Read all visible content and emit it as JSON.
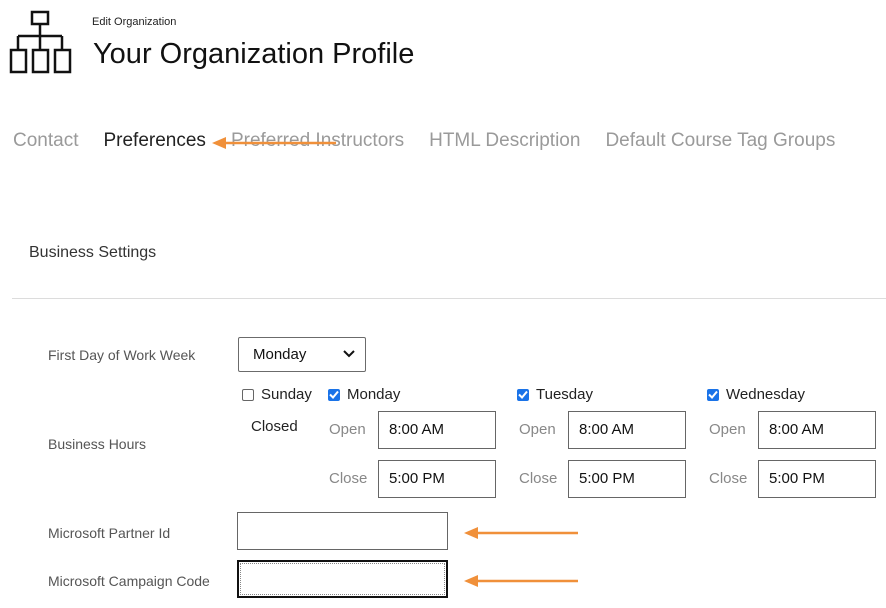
{
  "header": {
    "breadcrumb": "Edit Organization",
    "title": "Your Organization Profile",
    "icon": "org-chart-icon"
  },
  "tabs": [
    {
      "label": "Contact",
      "active": false
    },
    {
      "label": "Preferences",
      "active": true
    },
    {
      "label": "Preferred Instructors",
      "active": false
    },
    {
      "label": "HTML Description",
      "active": false
    },
    {
      "label": "Default Course Tag Groups",
      "active": false
    }
  ],
  "section": {
    "title": "Business Settings"
  },
  "form": {
    "first_day_label": "First Day of Work Week",
    "first_day_value": "Monday",
    "business_hours_label": "Business Hours",
    "days": [
      {
        "name": "Sunday",
        "checked": false,
        "closed_text": "Closed"
      },
      {
        "name": "Monday",
        "checked": true,
        "open_label": "Open",
        "open": "8:00 AM",
        "close_label": "Close",
        "close": "5:00 PM"
      },
      {
        "name": "Tuesday",
        "checked": true,
        "open_label": "Open",
        "open": "8:00 AM",
        "close_label": "Close",
        "close": "5:00 PM"
      },
      {
        "name": "Wednesday",
        "checked": true,
        "open_label": "Open",
        "open": "8:00 AM",
        "close_label": "Close",
        "close": "5:00 PM"
      }
    ],
    "partner_id_label": "Microsoft Partner Id",
    "partner_id_value": "",
    "campaign_code_label": "Microsoft Campaign Code",
    "campaign_code_value": ""
  },
  "annotation_color": "#f0903a"
}
